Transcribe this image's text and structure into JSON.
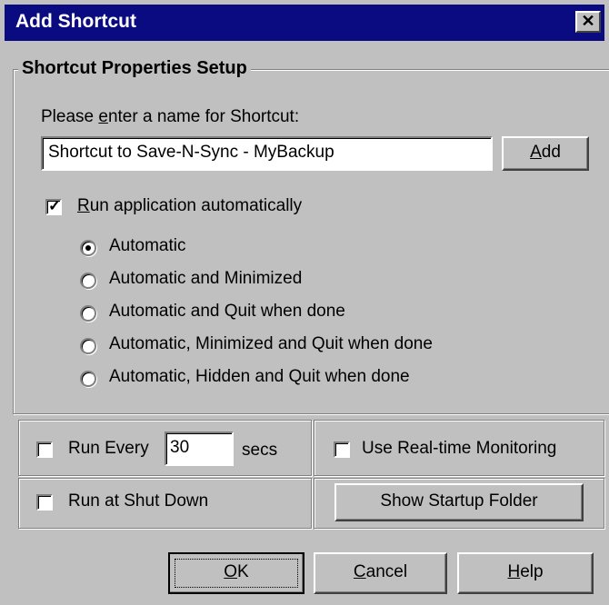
{
  "window": {
    "title": "Add Shortcut",
    "close_glyph": "✕"
  },
  "group": {
    "legend": "Shortcut Properties Setup"
  },
  "name_prompt": {
    "pre": "Please ",
    "accel": "e",
    "post": "nter a name for Shortcut:"
  },
  "name_field": {
    "value": "Shortcut to Save-N-Sync - MyBackup"
  },
  "add_button": {
    "accel": "A",
    "rest": "dd"
  },
  "run_auto": {
    "checked": true,
    "accel": "R",
    "rest": "un application automatically"
  },
  "radio_options": [
    {
      "label": "Automatic",
      "selected": true
    },
    {
      "label": "Automatic and Minimized",
      "selected": false
    },
    {
      "label": "Automatic and Quit when done",
      "selected": false
    },
    {
      "label": "Automatic, Minimized and Quit when done",
      "selected": false
    },
    {
      "label": "Automatic, Hidden and Quit when done",
      "selected": false
    }
  ],
  "run_every": {
    "checked": false,
    "label": "Run Every",
    "value": "30",
    "unit": "secs"
  },
  "realtime": {
    "checked": false,
    "label": "Use Real-time Monitoring"
  },
  "shutdown": {
    "checked": false,
    "label": "Run at Shut Down"
  },
  "startup_button": {
    "label": "Show Startup Folder"
  },
  "ok_button": {
    "accel": "O",
    "rest": "K"
  },
  "cancel_button": {
    "accel": "C",
    "rest": "ancel"
  },
  "help_button": {
    "accel": "H",
    "rest": "elp"
  },
  "check_glyph": "✓",
  "colors": {
    "titlebar": "#0a0b80",
    "face": "#c0c0c0"
  }
}
